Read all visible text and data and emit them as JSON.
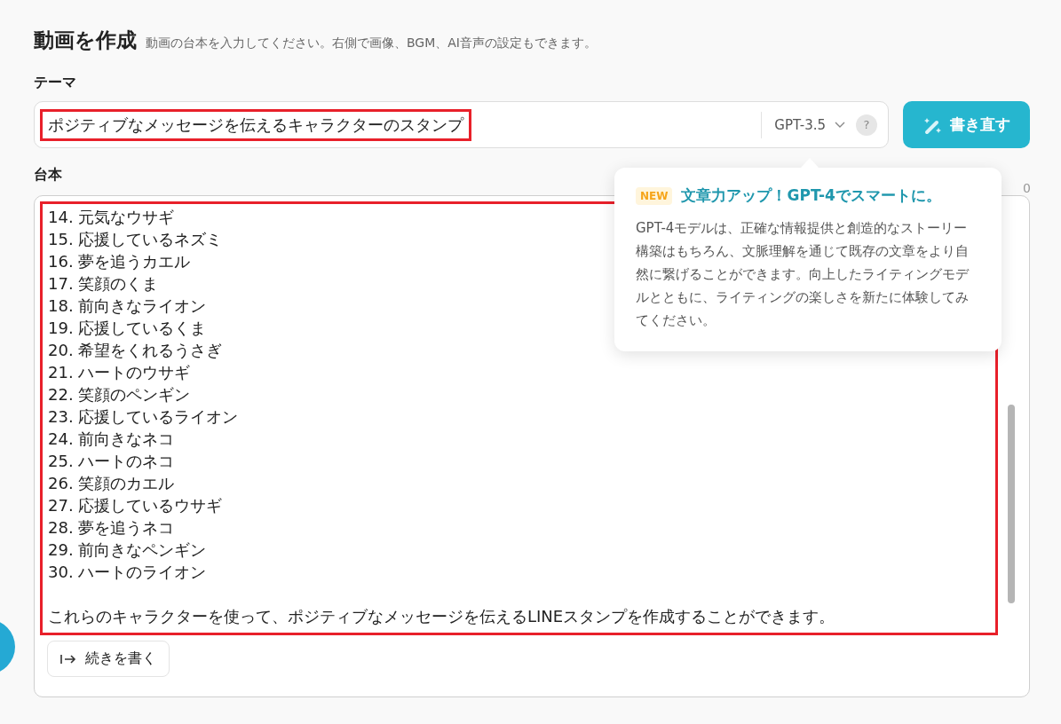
{
  "header": {
    "title": "動画を作成",
    "subtitle": "動画の台本を入力してください。右側で画像、BGM、AI音声の設定もできます。"
  },
  "theme": {
    "label": "テーマ",
    "value": "ポジティブなメッセージを伝えるキャラクターのスタンプ",
    "model": "GPT-3.5",
    "help": "?",
    "rewrite_button": "書き直す"
  },
  "script": {
    "label": "台本",
    "counter": "0",
    "lines": [
      "14. 元気なウサギ",
      "15. 応援しているネズミ",
      "16. 夢を追うカエル",
      "17. 笑顔のくま",
      "18. 前向きなライオン",
      "19. 応援しているくま",
      "20. 希望をくれるうさぎ",
      "21. ハートのウサギ",
      "22. 笑顔のペンギン",
      "23. 応援しているライオン",
      "24. 前向きなネコ",
      "25. ハートのネコ",
      "26. 笑顔のカエル",
      "27. 応援しているウサギ",
      "28. 夢を追うネコ",
      "29. 前向きなペンギン",
      "30. ハートのライオン"
    ],
    "closing": "これらのキャラクターを使って、ポジティブなメッセージを伝えるLINEスタンプを作成することができます。",
    "continue_button": "続きを書く"
  },
  "popover": {
    "badge": "NEW",
    "title": "文章力アップ！GPT-4でスマートに。",
    "body": "GPT-4モデルは、正確な情報提供と創造的なストーリー構築はもちろん、文脈理解を通じて既存の文章をより自然に繋げることができます。向上したライティングモデルとともに、ライティングの楽しさを新たに体験してみてください。"
  }
}
